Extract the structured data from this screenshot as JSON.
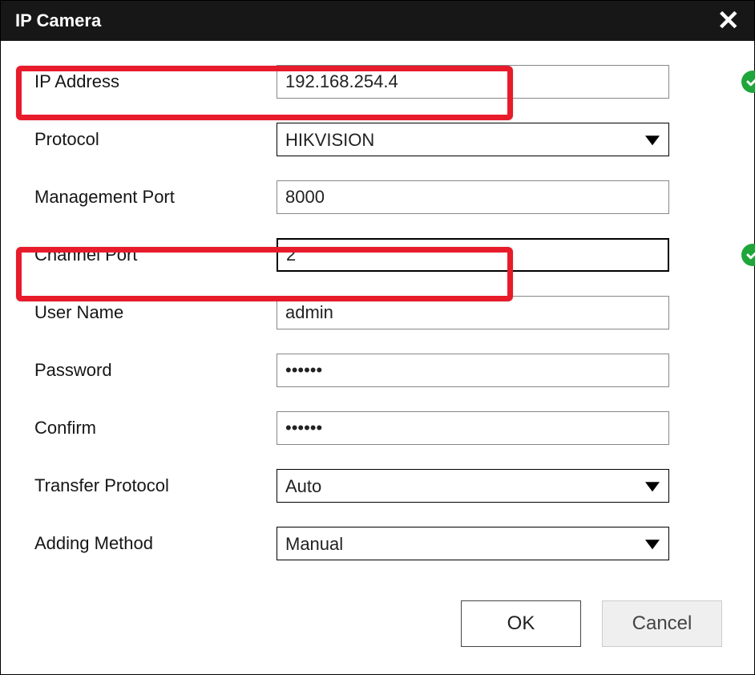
{
  "dialog": {
    "title": "IP Camera"
  },
  "labels": {
    "ip": "IP Address",
    "protocol": "Protocol",
    "mport": "Management Port",
    "cport": "Channel Port",
    "user": "User Name",
    "pass": "Password",
    "confirm": "Confirm",
    "tproto": "Transfer Protocol",
    "amethod": "Adding Method"
  },
  "values": {
    "ip": "192.168.254.4",
    "protocol": "HIKVISION",
    "mport": "8000",
    "cport": "2",
    "user": "admin",
    "pass": "••••••",
    "confirm": "••••••",
    "tproto": "Auto",
    "amethod": "Manual"
  },
  "buttons": {
    "ok": "OK",
    "cancel": "Cancel"
  }
}
